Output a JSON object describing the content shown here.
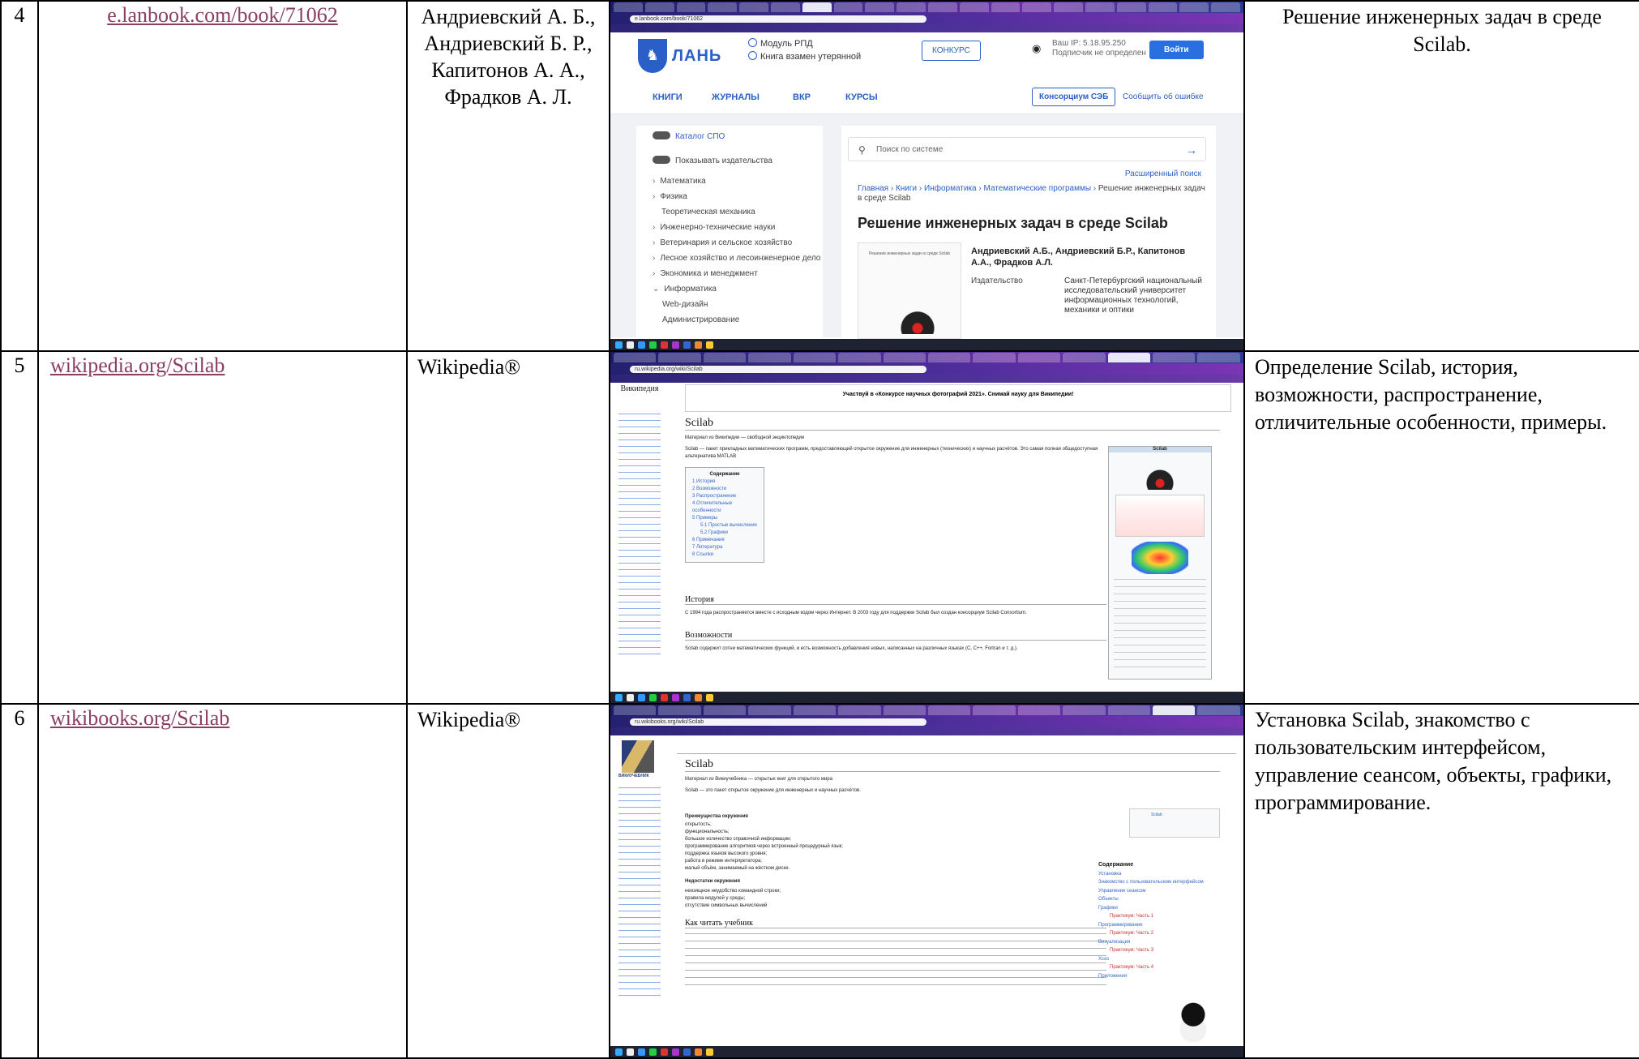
{
  "rows": [
    {
      "num": "4",
      "link": "e.lanbook.com/book/71062",
      "authors": "Андриевский А. Б., Андриевский Б. Р., Капитонов А. А., Фрадков А. Л.",
      "description": "Решение инженерных задач в среде Scilab.",
      "shot": {
        "url": "e.lanbook.com/book/71062",
        "brand": "ЛАНЬ",
        "rpd": "Модуль РПД",
        "lost": "Книга взамен утерянной",
        "konkurs": "КОНКУРС",
        "ip": "Ваш IP: 5.18.95.250",
        "subscriber": "Подписчик не определен",
        "login": "Войти",
        "nav": [
          "КНИГИ",
          "ЖУРНАЛЫ",
          "ВКР",
          "КУРСЫ"
        ],
        "consortium": "Консорциум СЭБ",
        "report": "Сообщить об ошибке",
        "catalog": "Каталог СПО",
        "show_publishers": "Показывать издательства",
        "sidebar": [
          "Математика",
          "Физика",
          "Теоретическая механика",
          "Инженерно-технические науки",
          "Ветеринария и сельское хозяйство",
          "Лесное хозяйство и лесоинженерное дело",
          "Экономика и менеджмент",
          "Информатика",
          "Web-дизайн",
          "Администрирование"
        ],
        "search_placeholder": "Поиск по системе",
        "advanced": "Расширенный поиск",
        "breadcrumb": [
          "Главная",
          "Книги",
          "Информатика",
          "Математические программы"
        ],
        "breadcrumb_current": "Решение инженерных задач в среде Scilab",
        "title": "Решение инженерных задач в среде Scilab",
        "authors": "Андриевский А.Б., Андриевский Б.Р., Капитонов А.А., Фрадков А.Л.",
        "publisher_label": "Издательство",
        "publisher": "Санкт-Петербургский национальный исследовательский университет информационных технологий, механики и оптики"
      }
    },
    {
      "num": "5",
      "link": "wikipedia.org/Scilab",
      "authors": "Wikipedia®",
      "description": "Определение Scilab, история, возможности, распространение, отличительные особенности, примеры.",
      "shot": {
        "url": "ru.wikipedia.org/wiki/Scilab",
        "logo": "Википедия",
        "banner": "Участвуй в «Конкурсе научных фотографий 2021». Снимай науку для Википедии!",
        "h1": "Scilab",
        "from": "Материал из Википедии — свободной энциклопедии",
        "intro": "Scilab — пакет прикладных математических программ, предоставляющий открытое окружение для инженерных (технических) и научных расчётов. Это самая полная общедоступная альтернатива MATLAB",
        "toc_title": "Содержание",
        "toc": [
          "1 История",
          "2 Возможности",
          "3 Распространение",
          "4 Отличительные особенности",
          "5 Примеры",
          "5.1 Простые вычисления",
          "5.2 Графики",
          "6 Примечания",
          "7 Литература",
          "8 Ссылки"
        ],
        "h2_history": "История",
        "history": "С 1994 года распространяется вместе с исходным кодом через Интернет. В 2003 году для поддержки Scilab был создан консорциум Scilab Consortium.",
        "h2_features": "Возможности",
        "features": "Scilab содержит сотни математических функций, и есть возможность добавления новых, написанных на различных языках (C, C++, Fortran и т. д.).",
        "infobox_title": "Scilab"
      }
    },
    {
      "num": "6",
      "link": "wikibooks.org/Scilab",
      "authors": "Wikipedia®",
      "description": "Установка Scilab, знакомство с пользовательским интерфейсом, управление сеансом, объекты, графики, программирование.",
      "shot": {
        "url": "ru.wikibooks.org/wiki/Scilab",
        "logo": "ВИКИУЧЕБНИК",
        "h1": "Scilab",
        "from": "Материал из Викиучебника — открытых книг для открытого мира",
        "intro": "Scilab — это пакет открытое окружение для инженерных и научных расчётов.",
        "adv_title": "Преимущества окружения",
        "adv": [
          "открытость;",
          "функциональность;",
          "большое количество справочной информации;",
          "программирование алгоритмов через встроенный процедурный язык;",
          "поддержка языков высокого уровня;",
          "работа в режиме интерпретатора;",
          "малый объём, занимаемый на жёстком диске."
        ],
        "dis_title": "Недостатки окружения",
        "dis": [
          "неизящное неудобство командной строки;",
          "правила модулей у среды;",
          "отсутствие символьных вычислений"
        ],
        "h2_how": "Как читать учебник",
        "toc_title": "Содержание",
        "toc": [
          "Установка",
          "Знакомство с пользовательским интерфейсом",
          "Управление сеансом",
          "Объекты",
          "Графики",
          "Практикум: Часть 1",
          "Программирование",
          "Практикум: Часть 2",
          "Визуализация",
          "Практикум: Часть 3",
          "Xcos",
          "Практикум: Часть 4",
          "Приложения"
        ]
      }
    }
  ]
}
